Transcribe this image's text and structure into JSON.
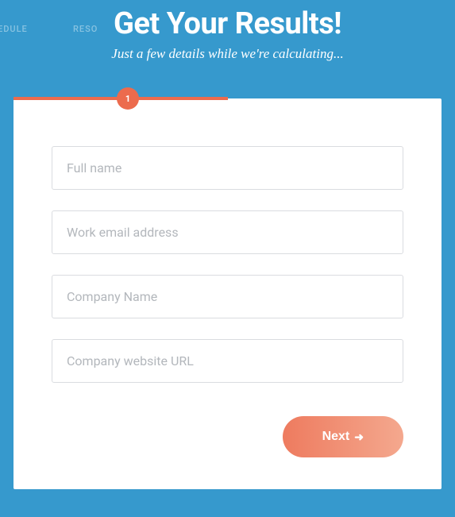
{
  "background": {
    "nav1": "CHEDULE",
    "nav2": "RESO"
  },
  "header": {
    "title": "Get Your Results!",
    "subtitle": "Just a few details while we're calculating..."
  },
  "progress": {
    "step": "1"
  },
  "form": {
    "fullname": {
      "placeholder": "Full name",
      "value": ""
    },
    "email": {
      "placeholder": "Work email address",
      "value": ""
    },
    "company": {
      "placeholder": "Company Name",
      "value": ""
    },
    "website": {
      "placeholder": "Company website URL",
      "value": ""
    }
  },
  "buttons": {
    "next": "Next"
  }
}
